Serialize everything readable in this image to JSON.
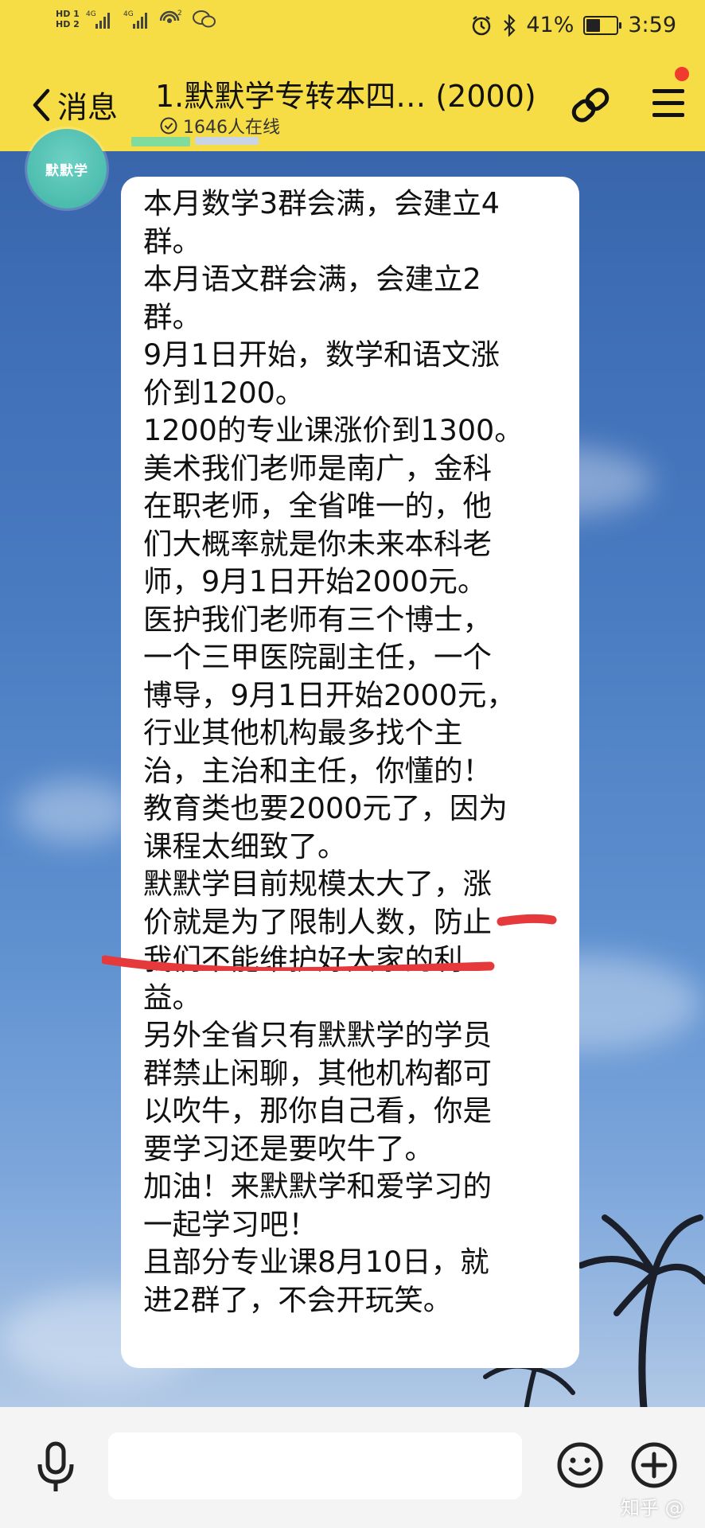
{
  "status_bar": {
    "hd1": "HD 1",
    "hd2": "HD 2",
    "net1": "4G",
    "net2": "4G",
    "wifi_sup": "2",
    "battery": "41%",
    "time": "3:59"
  },
  "header": {
    "back_label": "消息",
    "title": "1.默默学专转本四…  (2000)",
    "online": "1646人在线"
  },
  "avatar": {
    "text": "默默学"
  },
  "message": {
    "lines": [
      "本月数学3群会满，会建立4",
      "群。",
      "本月语文群会满，会建立2",
      "群。",
      "9月1日开始，数学和语文涨",
      "价到1200。",
      "1200的专业课涨价到1300。",
      "美术我们老师是南广，金科",
      "在职老师，全省唯一的，他",
      "们大概率就是你未来本科老",
      "师，9月1日开始2000元。",
      "医护我们老师有三个博士，",
      "一个三甲医院副主任，一个",
      "博导，9月1日开始2000元，",
      "行业其他机构最多找个主",
      "治，主治和主任，你懂的！",
      "教育类也要2000元了，因为",
      "课程太细致了。",
      "默默学目前规模太大了，涨",
      "价就是为了限制人数，防止",
      "我们不能维护好大家的利",
      "益。",
      "另外全省只有默默学的学员",
      "群禁止闲聊，其他机构都可",
      "以吹牛，那你自己看，你是",
      "要学习还是要吹牛了。",
      "加油！来默默学和爱学习的",
      "一起学习吧！",
      "且部分专业课8月10日，就",
      "进2群了，不会开玩笑。"
    ]
  },
  "watermark": "知乎 @",
  "colors": {
    "header_bg": "#f7dd45",
    "bubble_bg": "#ffffff",
    "underline": "#e5393b",
    "avatar_bg": "#4fc0b1"
  }
}
